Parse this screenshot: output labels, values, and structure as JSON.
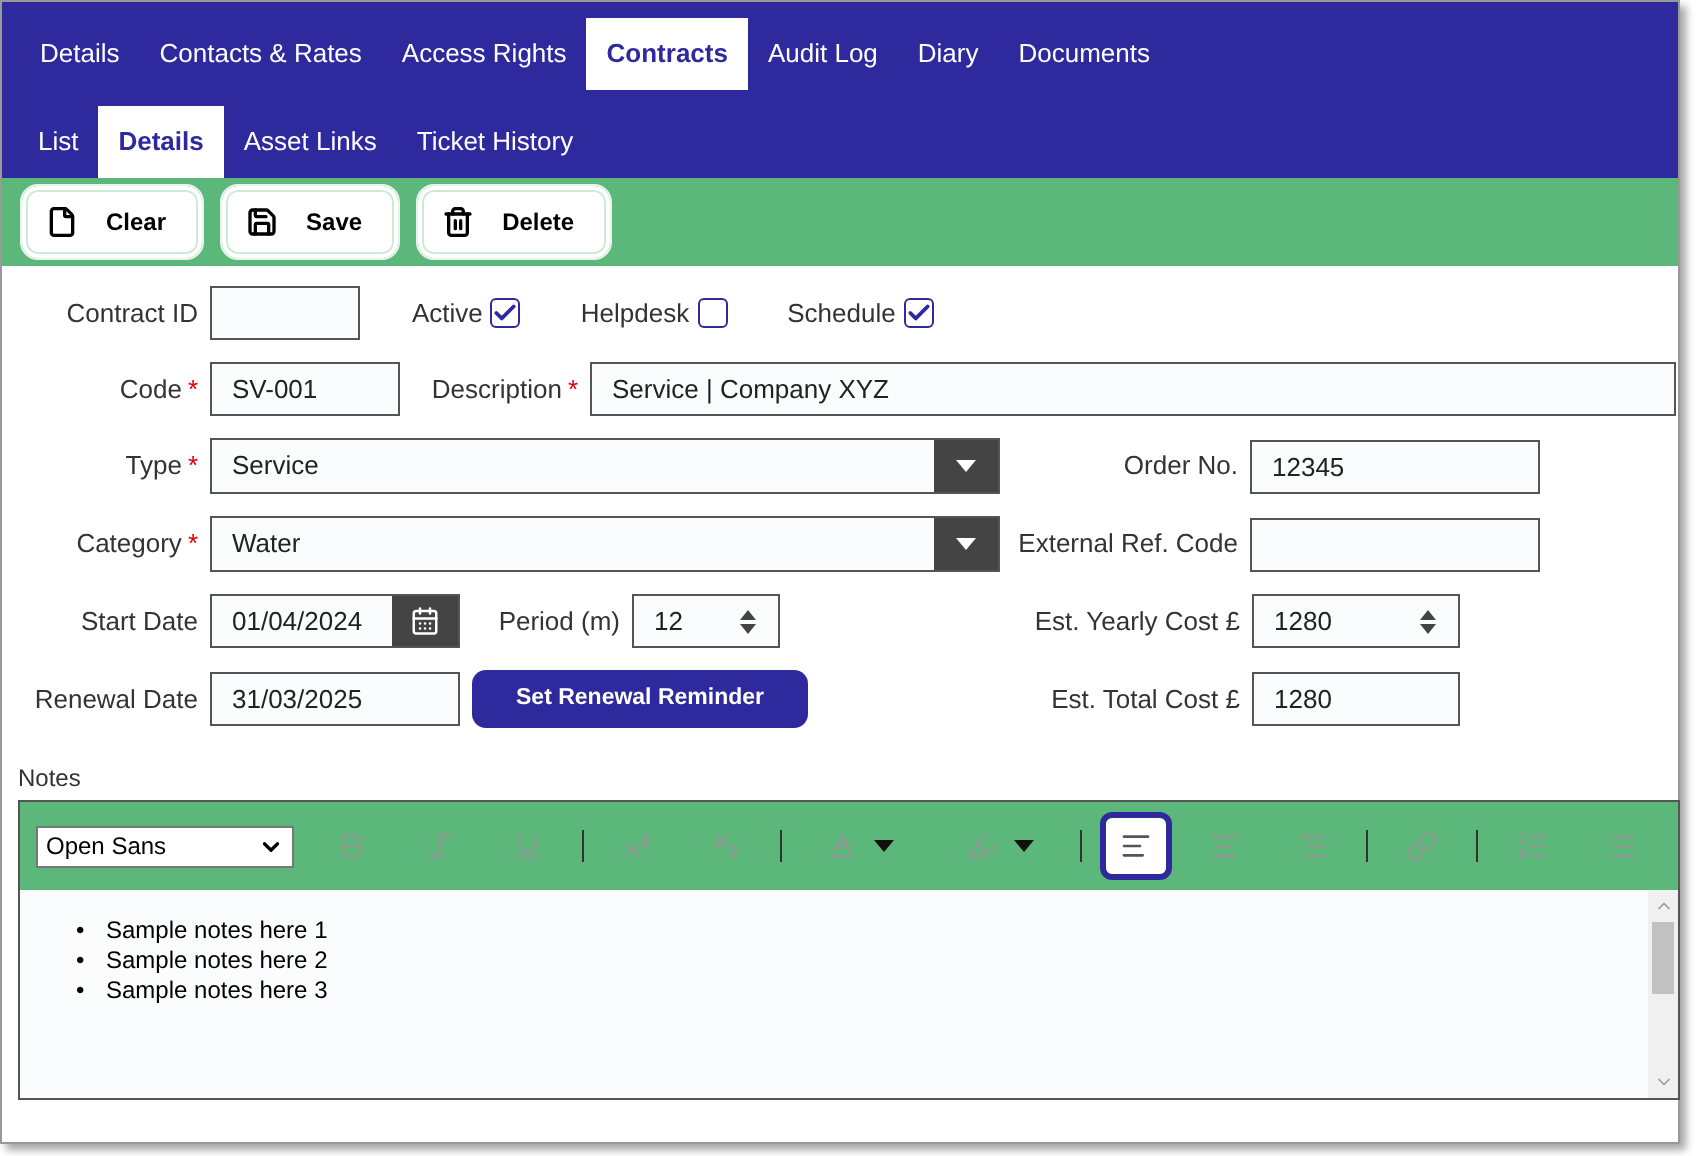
{
  "tabs": [
    {
      "label": "Details",
      "selected": false
    },
    {
      "label": "Contacts & Rates",
      "selected": false
    },
    {
      "label": "Access Rights",
      "selected": false
    },
    {
      "label": "Contracts",
      "selected": true
    },
    {
      "label": "Audit Log",
      "selected": false
    },
    {
      "label": "Diary",
      "selected": false
    },
    {
      "label": "Documents",
      "selected": false
    }
  ],
  "subtabs": [
    {
      "label": "List",
      "selected": false
    },
    {
      "label": "Details",
      "selected": true
    },
    {
      "label": "Asset Links",
      "selected": false
    },
    {
      "label": "Ticket History",
      "selected": false
    }
  ],
  "toolbar": [
    {
      "kind": "clear",
      "label": "Clear"
    },
    {
      "kind": "save",
      "label": "Save"
    },
    {
      "kind": "delete",
      "label": "Delete"
    }
  ],
  "contract_id": {
    "label": "Contract ID"
  },
  "checkboxes": [
    {
      "label": "Active",
      "checked": true
    },
    {
      "label": "Helpdesk",
      "checked": false
    },
    {
      "label": "Schedule",
      "checked": true
    }
  ],
  "code": {
    "label": "Code",
    "required_mark": "*",
    "value": "SV-001"
  },
  "description": {
    "label": "Description",
    "required_mark": "*",
    "value": "Service | Company XYZ"
  },
  "type": {
    "label": "Type",
    "required_mark": "*",
    "value": "Service"
  },
  "order_no": {
    "label": "Order No.",
    "value": "12345"
  },
  "category": {
    "label": "Category",
    "required_mark": "*",
    "value": "Water"
  },
  "external_ref": {
    "label": "External Ref. Code"
  },
  "start_date": {
    "label": "Start Date",
    "value": "01/04/2024"
  },
  "period": {
    "label": "Period (m)",
    "value": "12"
  },
  "yearly_cost": {
    "label": "Est. Yearly Cost £",
    "value": "1280"
  },
  "renewal_date": {
    "label": "Renewal Date",
    "value": "31/03/2025"
  },
  "reminder_button": "Set Renewal Reminder",
  "total_cost": {
    "label": "Est. Total Cost £",
    "value": "1280"
  },
  "notes": {
    "label": "Notes",
    "font": "Open Sans",
    "tools": [
      {
        "kind": "bold",
        "selected": false
      },
      {
        "kind": "italic",
        "selected": false
      },
      {
        "kind": "underline",
        "selected": false
      },
      {
        "kind": "sep"
      },
      {
        "kind": "superscript",
        "selected": false
      },
      {
        "kind": "subscript",
        "selected": false
      },
      {
        "kind": "sep"
      },
      {
        "kind": "text-color",
        "selected": false
      },
      {
        "kind": "background",
        "selected": false
      },
      {
        "kind": "sep"
      },
      {
        "kind": "align-left",
        "selected": true
      },
      {
        "kind": "align-center",
        "selected": false
      },
      {
        "kind": "align-right",
        "selected": false
      },
      {
        "kind": "sep"
      },
      {
        "kind": "link",
        "selected": false
      },
      {
        "kind": "sep"
      },
      {
        "kind": "ordered-list",
        "selected": false
      },
      {
        "kind": "bullet-list",
        "selected": false
      }
    ],
    "items": [
      {
        "bullet": "•",
        "text": "Sample notes here 1"
      },
      {
        "bullet": "•",
        "text": "Sample notes here 2"
      },
      {
        "bullet": "•",
        "text": "Sample notes here 3"
      }
    ]
  }
}
